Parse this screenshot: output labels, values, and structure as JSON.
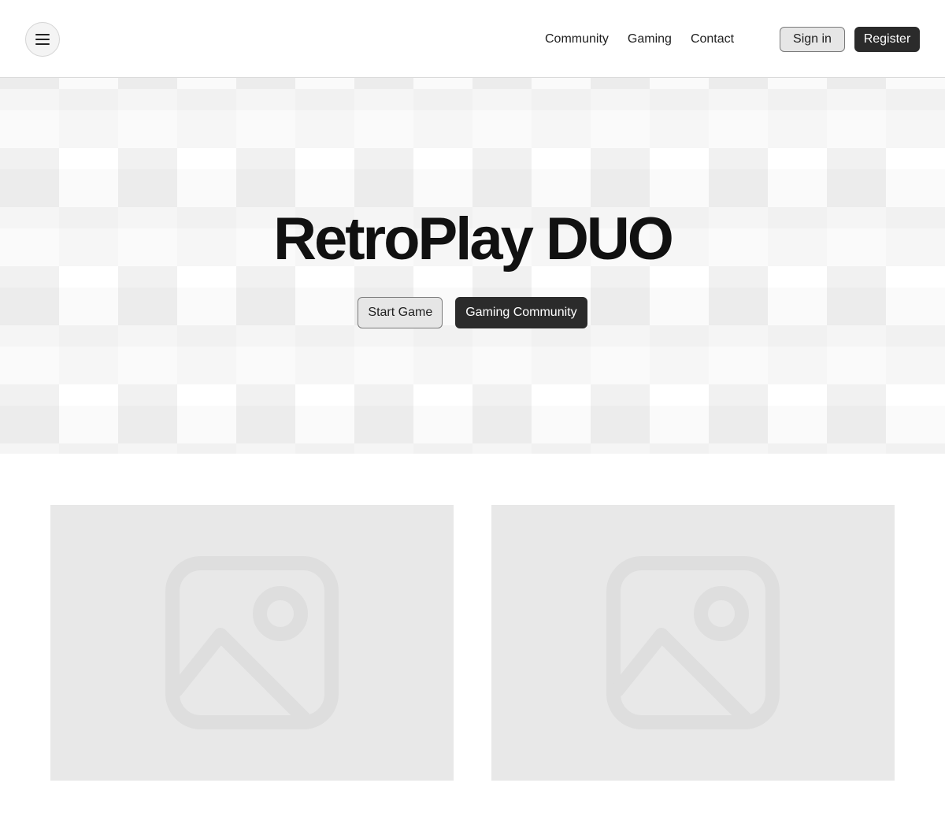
{
  "navbar": {
    "menu_icon": "hamburger-menu-icon",
    "links": [
      {
        "label": "Community"
      },
      {
        "label": "Gaming"
      },
      {
        "label": "Contact"
      }
    ],
    "sign_in_label": "Sign in",
    "register_label": "Register"
  },
  "hero": {
    "title": "RetroPlay DUO",
    "primary_label": "Start Game",
    "secondary_label": "Gaming Community"
  },
  "gallery": {
    "items": [
      {
        "icon": "image-placeholder-icon"
      },
      {
        "icon": "image-placeholder-icon"
      }
    ]
  },
  "colors": {
    "dark_button": "#2b2b2b",
    "light_button": "#e6e6e6",
    "placeholder": "#e8e8e8",
    "placeholder_icon": "#dedede"
  }
}
